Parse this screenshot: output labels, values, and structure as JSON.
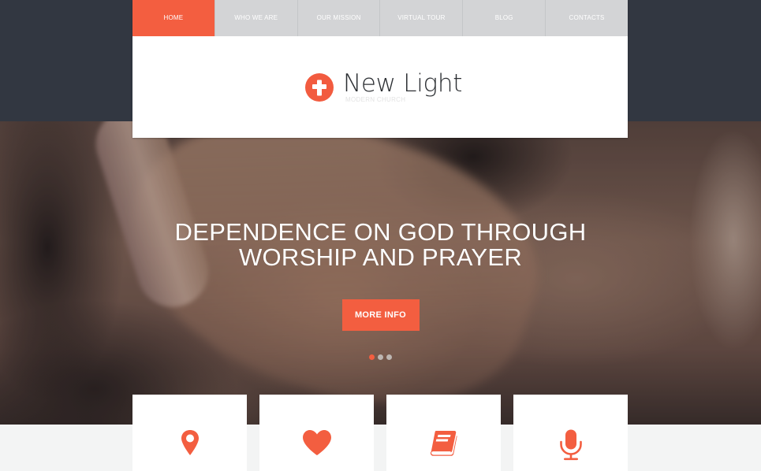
{
  "nav": {
    "items": [
      {
        "label": "HOME",
        "active": true
      },
      {
        "label": "WHO WE ARE",
        "active": false
      },
      {
        "label": "OUR MISSION",
        "active": false
      },
      {
        "label": "VIRTUAL TOUR",
        "active": false
      },
      {
        "label": "BLOG",
        "active": false
      },
      {
        "label": "CONTACTS",
        "active": false
      }
    ]
  },
  "logo": {
    "icon": "cross-icon",
    "name": "New Light",
    "tagline": "MODERN CHURCH"
  },
  "hero": {
    "title_line1": "DEPENDENCE ON GOD THROUGH",
    "title_line2": "WORSHIP AND PRAYER",
    "button_label": "MORE INFO",
    "slides_total": 3,
    "active_slide": 1
  },
  "cards": [
    {
      "icon": "map-pin-icon"
    },
    {
      "icon": "heart-icon"
    },
    {
      "icon": "book-icon"
    },
    {
      "icon": "microphone-icon"
    }
  ],
  "colors": {
    "accent": "#f35e40",
    "dark_band": "#323741",
    "nav_inactive": "#d3d4d6",
    "page_bg": "#f3f4f4"
  }
}
